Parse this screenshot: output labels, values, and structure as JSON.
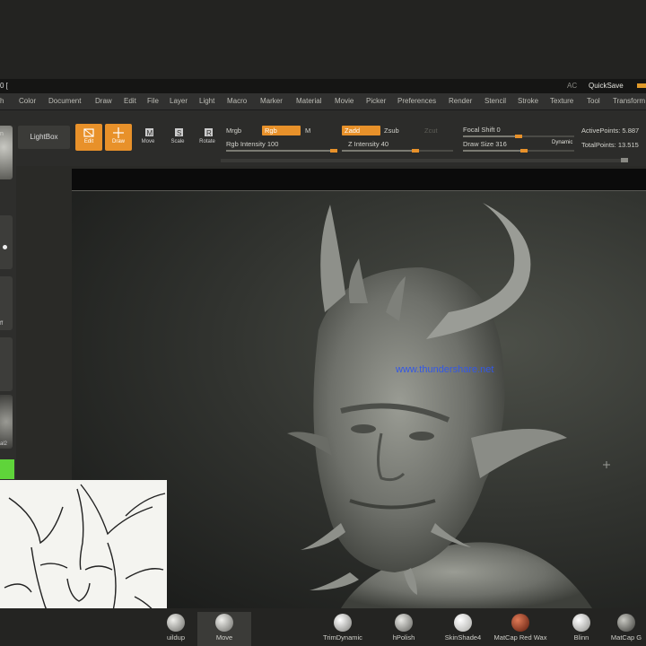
{
  "titlebar": {
    "left_text": "0 [",
    "ac": "AC",
    "quicksave": "QuickSave"
  },
  "menu": [
    "h",
    "Color",
    "Document",
    "Draw",
    "Edit",
    "File",
    "Layer",
    "Light",
    "Macro",
    "Marker",
    "Material",
    "Movie",
    "Picker",
    "Preferences",
    "Render",
    "Stencil",
    "Stroke",
    "Texture",
    "Tool",
    "Transform"
  ],
  "toolbar": {
    "lightbox": "LightBox",
    "edit": "Edit",
    "draw": "Draw",
    "move": "Move",
    "scale": "Scale",
    "rotate": "Rotate",
    "mrgb": "Mrgb",
    "rgb": "Rgb",
    "m": "M",
    "rgb_intensity": "Rgb Intensity 100",
    "zadd": "Zadd",
    "zsub": "Zsub",
    "zcut": "Zcut",
    "z_intensity": "Z Intensity 40",
    "focal_shift": "Focal Shift 0",
    "draw_size": "Draw Size 316",
    "dynamic": "Dynamic",
    "active_points": "ActivePoints: 5.887",
    "total_points": "TotalPoints: 13.515"
  },
  "left_panel": {
    "labels": [
      "n",
      "ff",
      "al2"
    ]
  },
  "canvas": {
    "watermark": "www.thundershare.net"
  },
  "materials": [
    {
      "label": "uildup",
      "color": "#d6d6d0"
    },
    {
      "label": "Move",
      "color": "#d6d6d0"
    },
    {
      "label": "TrimDynamic",
      "color": "#e2e2de"
    },
    {
      "label": "hPolish",
      "color": "#d0d0ca"
    },
    {
      "label": "SkinShade4",
      "color": "#ececea"
    },
    {
      "label": "MatCap Red Wax",
      "color": "#b44a28"
    },
    {
      "label": "Blinn",
      "color": "#dcdcd8"
    },
    {
      "label": "MatCap G",
      "color": "#8a8a84"
    }
  ],
  "colors": {
    "accent": "#e8912a",
    "watermark": "#3358e6",
    "green_swatch": "#5fd43a"
  }
}
